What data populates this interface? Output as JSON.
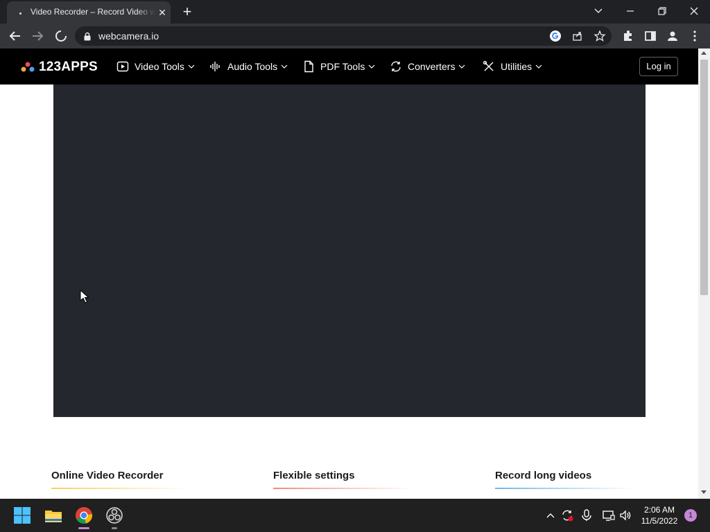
{
  "browser": {
    "tab_title": "Video Recorder – Record Video with Webcam",
    "url": "webcamera.io"
  },
  "site": {
    "logo_text": "123APPS",
    "nav": [
      {
        "label": "Video Tools",
        "icon": "play-icon"
      },
      {
        "label": "Audio Tools",
        "icon": "waveform-icon"
      },
      {
        "label": "PDF Tools",
        "icon": "document-icon"
      },
      {
        "label": "Converters",
        "icon": "convert-icon"
      },
      {
        "label": "Utilities",
        "icon": "tools-icon"
      }
    ],
    "login_label": "Log in"
  },
  "features": [
    {
      "title": "Online Video Recorder",
      "color": "#f5d25a"
    },
    {
      "title": "Flexible settings",
      "color": "#f08a7a"
    },
    {
      "title": "Record long videos",
      "color": "#6fb6e8"
    }
  ],
  "taskbar": {
    "time": "2:06 AM",
    "date": "11/5/2022",
    "notification_count": "1"
  },
  "colors": {
    "video_bg": "#25272e",
    "nav_bg": "#000000",
    "browser_dark": "#202124"
  }
}
